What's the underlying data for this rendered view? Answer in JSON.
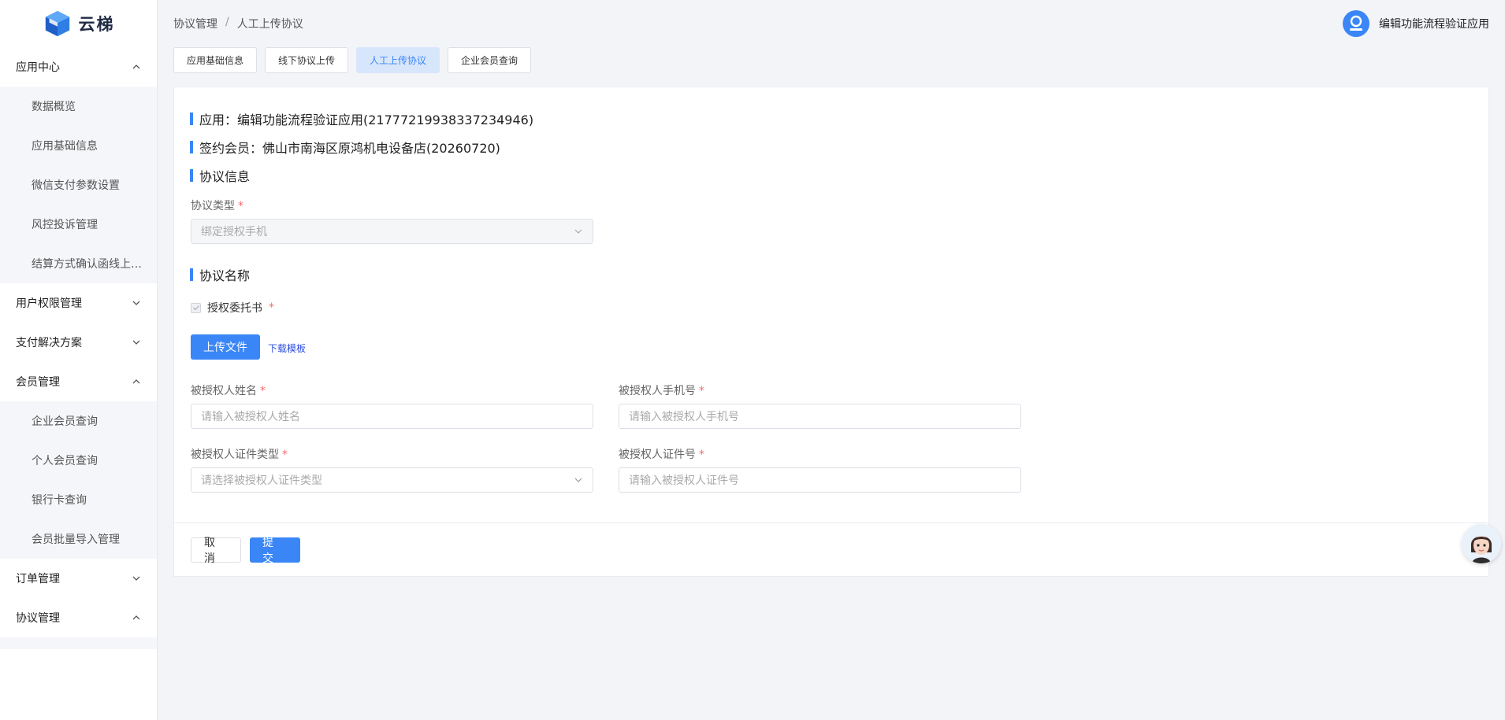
{
  "brand": {
    "name": "云梯"
  },
  "sidebar": {
    "groups": [
      {
        "label": "应用中心",
        "expanded": true,
        "items": [
          "数据概览",
          "应用基础信息",
          "微信支付参数设置",
          "风控投诉管理",
          "结算方式确认函线上…"
        ]
      },
      {
        "label": "用户权限管理",
        "expanded": false,
        "items": []
      },
      {
        "label": "支付解决方案",
        "expanded": false,
        "items": []
      },
      {
        "label": "会员管理",
        "expanded": true,
        "items": [
          "企业会员查询",
          "个人会员查询",
          "银行卡查询",
          "会员批量导入管理"
        ]
      },
      {
        "label": "订单管理",
        "expanded": false,
        "items": []
      },
      {
        "label": "协议管理",
        "expanded": true,
        "items": []
      }
    ]
  },
  "header": {
    "breadcrumb": [
      "协议管理",
      "人工上传协议"
    ],
    "breadcrumb_sep": "/",
    "user_name": "编辑功能流程验证应用"
  },
  "tabs": [
    {
      "label": "应用基础信息",
      "active": false
    },
    {
      "label": "线下协议上传",
      "active": false
    },
    {
      "label": "人工上传协议",
      "active": true
    },
    {
      "label": "企业会员查询",
      "active": false
    }
  ],
  "form": {
    "app_line": "应用：编辑功能流程验证应用(2177721993833723494​6)",
    "member_line": "签约会员：佛山市南海区原鸿机电设备店(20260720)",
    "section_info": "协议信息",
    "protocol_type_label": "协议类型",
    "protocol_type_value": "绑定授权手机",
    "section_name": "协议名称",
    "checkbox_label": "授权委托书",
    "checkbox_checked": true,
    "upload_button": "上传文件",
    "download_link": "下载模板",
    "grantee_name_label": "被授权人姓名",
    "grantee_name_placeholder": "请输入被授权人姓名",
    "grantee_phone_label": "被授权人手机号",
    "grantee_phone_placeholder": "请输入被授权人手机号",
    "grantee_idtype_label": "被授权人证件类型",
    "grantee_idtype_placeholder": "请选择被授权人证件类型",
    "grantee_idno_label": "被授权人证件号",
    "grantee_idno_placeholder": "请输入被授权人证件号",
    "required_mark": "*"
  },
  "footer": {
    "cancel": "取 消",
    "submit": "提 交"
  },
  "colors": {
    "primary": "#3a86f7",
    "required": "#f56c6c",
    "link": "#2a4be0"
  }
}
